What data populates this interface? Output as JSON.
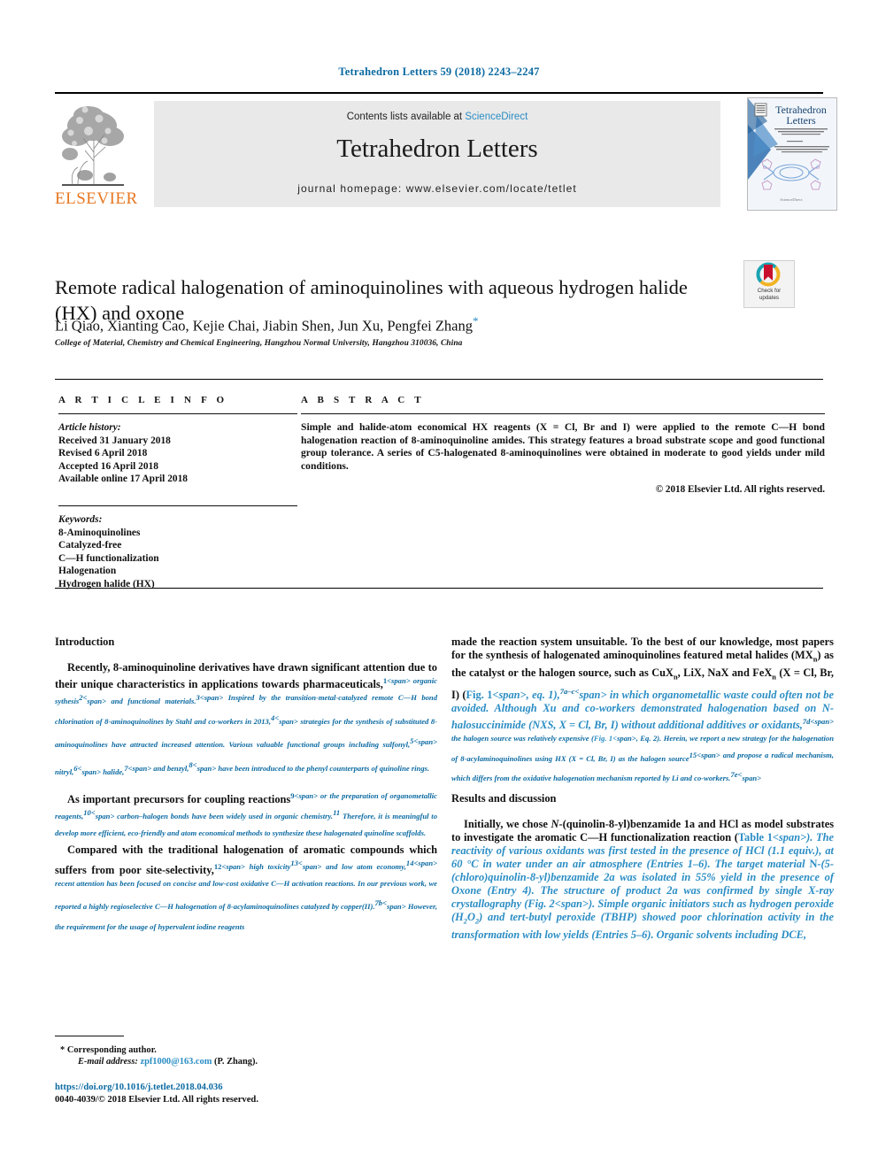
{
  "running_head": "Tetrahedron Letters 59 (2018) 2243–2247",
  "masthead": {
    "publisher_name": "ELSEVIER",
    "contents_prefix": "Contents lists available at ",
    "sciencedirect": "ScienceDirect",
    "journal_title": "Tetrahedron Letters",
    "homepage": "journal homepage: www.elsevier.com/locate/tetlet",
    "cover_title_line1": "Tetrahedron",
    "cover_title_line2": "Letters"
  },
  "article": {
    "title": "Remote radical halogenation of aminoquinolines with aqueous hydrogen halide (HX) and oxone",
    "authors": "Li Qiao, Xianting Cao, Kejie Chai, Jiabin Shen, Jun Xu, Pengfei Zhang",
    "corresponding_marker": "*",
    "affiliation": "College of Material, Chemistry and Chemical Engineering, Hangzhou Normal University, Hangzhou 310036, China",
    "crossmark_label_line1": "Check for",
    "crossmark_label_line2": "updates"
  },
  "article_info": {
    "heading": "A R T I C L E   I N F O",
    "history_heading": "Article history:",
    "history": [
      "Received 31 January 2018",
      "Revised 6 April 2018",
      "Accepted 16 April 2018",
      "Available online 17 April 2018"
    ],
    "keywords_heading": "Keywords:",
    "keywords": [
      "8-Aminoquinolines",
      "Catalyzed-free",
      "C—H functionalization",
      "Halogenation",
      "Hydrogen halide (HX)"
    ]
  },
  "abstract": {
    "heading": "A B S T R A C T",
    "text": "Simple and halide-atom economical HX reagents (X = Cl, Br and I) were applied to the remote C—H bond halogenation reaction of 8-aminoquinoline amides. This strategy features a broad substrate scope and good functional group tolerance. A series of C5-halogenated 8-aminoquinolines were obtained in moderate to good yields under mild conditions.",
    "copyright": "© 2018 Elsevier Ltd. All rights reserved."
  },
  "body": {
    "intro_heading": "Introduction",
    "results_heading": "Results and discussion",
    "left_paragraphs": [
      "Recently, 8-aminoquinoline derivatives have drawn significant attention due to their unique characteristics in applications towards pharmaceuticals,|1| organic sythesis|2| and functional materials.|3| Inspired by the transition-metal-catalyzed remote C—H bond chlorination of 8-aminoquinolines by Stahl and co-workers in 2013,|4| strategies for the synthesis of substituted 8-aminoquinolines have attracted increased attention. Various valuable functional groups including sulfonyl,|5| nitryl,|6| halide,|7| and benzyl,|8| have been introduced to the phenyl counterparts of quinoline rings.",
      "As important precursors for coupling reactions|9| or the preparation of organometallic reagents,|10| carbon–halogen bonds have been widely used in organic chemistry.|11| Therefore, it is meaningful to develop more efficient, eco-friendly and atom economical methods to synthesize these halogenated quinoline scaffolds.",
      "Compared with the traditional halogenation of aromatic compounds which suffers from poor site-selectivity,|12| high toxicity|13| and low atom economy,|14| recent attention has been focused on concise and low-cost oxidative C—H activation reactions. In our previous work, we reported a highly regioselective C—H halogenation of 8-acylaminoquinolines catalyzed by copper(II).|7b| However, the requirement for the usage of hypervalent iodine reagents"
    ],
    "right_paragraph_1": "made the reaction system unsuitable. To the best of our knowledge, most papers for the synthesis of halogenated aminoquinolines featured metal halides (MX#n) as the catalyst or the halogen source, such as CuX#n, LiX, NaX and FeX#n (X = Cl, Br, I) ([Fig. 1], eq. 1),|7a–c| in which organometallic waste could often not be avoided. Although Xu and co-workers demonstrated halogenation based on /N/-halosuccinimide (NXS, X = Cl, Br, I) without additional additives or oxidants,|7d| the halogen source was relatively expensive ([Fig. 1], Eq. 2). Herein, we report a new strategy for the halogenation of 8-acylaminoquinolines using HX (X = Cl, Br, I) as the halogen source|15| and propose a radical mechanism, which differs from the oxidative halogenation mechanism reported by Li and co-workers.|7e|",
    "right_paragraph_2": "Initially, we chose /N/-(quinolin-8-yl)benzamide *1a* and HCl as model substrates to investigate the aromatic C—H functionalization reaction ([Table 1]). The reactivity of various oxidants was first tested in the presence of HCl (1.1 equiv.), at 60 °C in water under an air atmosphere (Entries 1–6). The target material /N/-(5-(chloro)quinolin-8-yl)benzamide *2a* was isolated in 55% yield in the presence of Oxone (Entry 4). The structure of product *2a* was confirmed by single X-ray crystallography ([Fig. 2]). Simple organic initiators such as hydrogen peroxide (H#2O#2) and tert-butyl peroxide (TBHP) showed poor chlorination activity in the transformation with low yields (Entries 5–6). Organic solvents including DCE,"
  },
  "footnote": {
    "star": "*",
    "corresponding": "Corresponding author.",
    "email_label": "E-mail address:",
    "email": "zpf1000@163.com",
    "email_suffix": "(P. Zhang).",
    "doi": "https://doi.org/10.1016/j.tetlet.2018.04.036",
    "issn_line": "0040-4039/© 2018 Elsevier Ltd. All rights reserved."
  },
  "colors": {
    "link_blue": "#2a8dc4",
    "ref_blue": "#0b6aa2",
    "elsevier_orange": "#e87722",
    "banner_grey": "#e9e9e9"
  }
}
